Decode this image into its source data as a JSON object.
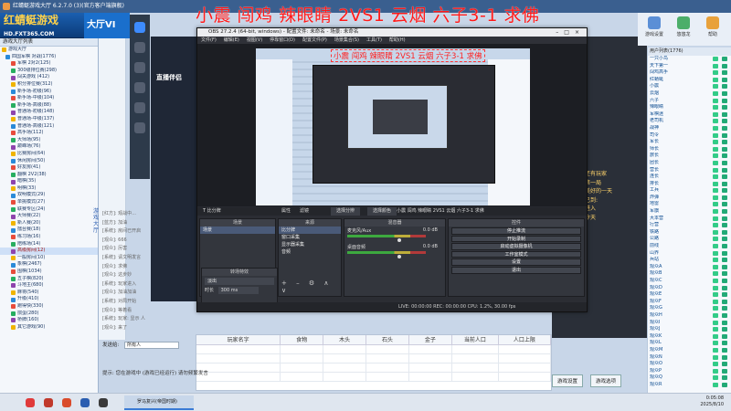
{
  "game_window": {
    "title": "红蜻蜓游戏大厅 6.2.7.0 (3)(官方客户端旗舰)",
    "logo": "红蜻蜓游戏",
    "logo_url": "HD.FXT365.COM",
    "hall": "大厅VI",
    "caption": "小震 闯鸡 辣眼睛 2VS1 云烟 六子3-1 求佛"
  },
  "tree": {
    "header": "游戏大厅列表",
    "items": [
      "游戏大厅",
      "四国军棋 对战(1776)",
      "军棋 2对2(125)",
      "300级排位赛(298)",
      "闯关游戏 (412)",
      "积分排位赛(312)",
      "新手场-初级(96)",
      "新手场-中级(104)",
      "新手场-高级(88)",
      "普通场-初级(148)",
      "普通场-中级(137)",
      "普通场-高级(121)",
      "高手场(112)",
      "大师场(95)",
      "巅峰场(76)",
      "比赛房间(64)",
      "休闲房间(50)",
      "好友房(41)",
      "翻棋 2V2(38)",
      "暗棋(35)",
      "明棋(33)",
      "双明模式(29)",
      "单挑模式(27)",
      "联赛专区(24)",
      "大师赛(22)",
      "新人赛(20)",
      "擂台赛(18)",
      "练习场(16)",
      "陪练场(14)",
      "高级房间(12)",
      "一般房间(10)",
      "象棋(2467)",
      "围棋(1034)",
      "五子棋(820)",
      "斗地主(680)",
      "麻将(540)",
      "升级(410)",
      "跑得快(330)",
      "掼蛋(280)",
      "桥牌(160)",
      "其它游戏(90)"
    ]
  },
  "left_vertical_label": "游戏大厅",
  "chat_lines": [
    "[红方]: 观战中...",
    "[蓝方]: 加油",
    "[系统]: 房间已开启",
    "[观众]: 666",
    "[观众]: 厉害",
    "[系统]: 请文明发言",
    "[观众]: 求佛",
    "[观众]: 这步妙",
    "[系统]: 玩家进入",
    "[观众]: 加油加油",
    "[系统]: 对局开始",
    "[观众]: 等着看",
    "[系统]: 玩家: 显示 人",
    "[观众]: 来了"
  ],
  "input": {
    "label": "发送给:",
    "value": "所有人"
  },
  "tip": "提示: 您在游戏中 (游戏已经运行) 请勿频繁发言",
  "live_app": {
    "brand": "直播伴侣"
  },
  "obs": {
    "title": "OBS 27.2.4 (64-bit, windows) - 配置文件: 未命名 - 场景: 未命名",
    "menu": [
      "文件(F)",
      "编辑(E)",
      "视图(V)",
      "停靠窗口(D)",
      "配置文件(P)",
      "场景集合(S)",
      "工具(T)",
      "帮助(H)"
    ],
    "inner_caption": "小震 闯鸡 辣眼睛 2VS1 云烟 六子3-1 求佛",
    "scene_tabs": {
      "scene_label": "比分牌",
      "props": "属性",
      "filters": "滤镜",
      "filter_mode": "选择分辨",
      "image_label": "选择颜色",
      "text_label": "小震 闯鸡 辣眼睛 2VS1 云烟 六子3-1 求佛"
    },
    "docks": {
      "scenes": {
        "title": "场景",
        "items": [
          "场景"
        ]
      },
      "sources": {
        "title": "来源",
        "items": [
          "比分牌",
          "窗口采集",
          "显示器采集",
          "音频"
        ]
      },
      "mixer": {
        "title": "混音器",
        "rows": [
          {
            "name": "麦克风/Aux",
            "db": "0.0 dB"
          },
          {
            "name": "桌面音频",
            "db": "0.0 dB"
          }
        ]
      },
      "transitions": {
        "title": "转场特效",
        "value": "淡出",
        "duration_label": "时长",
        "duration": "300 ms"
      },
      "controls": {
        "title": "控件",
        "buttons": [
          "停止推流",
          "开始录制",
          "启动虚拟摄像机",
          "工作室模式",
          "设置",
          "退出"
        ]
      }
    },
    "status": "LIVE: 00:00:00   REC: 00:00:00   CPU: 1.2%, 30.00 fps"
  },
  "res_table": {
    "headers": [
      "玩家名字",
      "食物",
      "木头",
      "石头",
      "金子",
      "当前人口",
      "人口上限"
    ]
  },
  "right_top": {
    "buttons": [
      "游戏设置",
      "悠悠龙",
      "帮助"
    ]
  },
  "right_list": {
    "header": "用户列表(1776)",
    "users": [
      "一只小鸟",
      "天下第一",
      "闯鸡高手",
      "红蜻蜓",
      "小震",
      "云烟",
      "六子",
      "辣眼睛",
      "军棋迷",
      "老司机",
      "战神",
      "司令",
      "军长",
      "师长",
      "旅长",
      "团长",
      "营长",
      "连长",
      "排长",
      "工兵",
      "炸弹",
      "地雷",
      "军旗",
      "大本营",
      "行营",
      "铁路",
      "公路",
      "前线",
      "山界",
      "兵站",
      "观众A",
      "观众B",
      "观众C",
      "观众D",
      "观众E",
      "观众F",
      "观众G",
      "观众H",
      "观众I",
      "观众J",
      "观众K",
      "观众L",
      "观众M",
      "观众N",
      "观众O",
      "观众P",
      "观众Q",
      "观众R"
    ]
  },
  "mid_right_text": [
    "还有玩家",
    "第一局",
    "美好的一天",
    "已到:",
    "进入",
    "今天"
  ],
  "bottom_buttons": [
    "游戏设置",
    "游戏选项"
  ],
  "taskbar": {
    "app": "罗马复兴(帝国时期)",
    "time": "0:05:08",
    "date": "2025/8/10"
  }
}
